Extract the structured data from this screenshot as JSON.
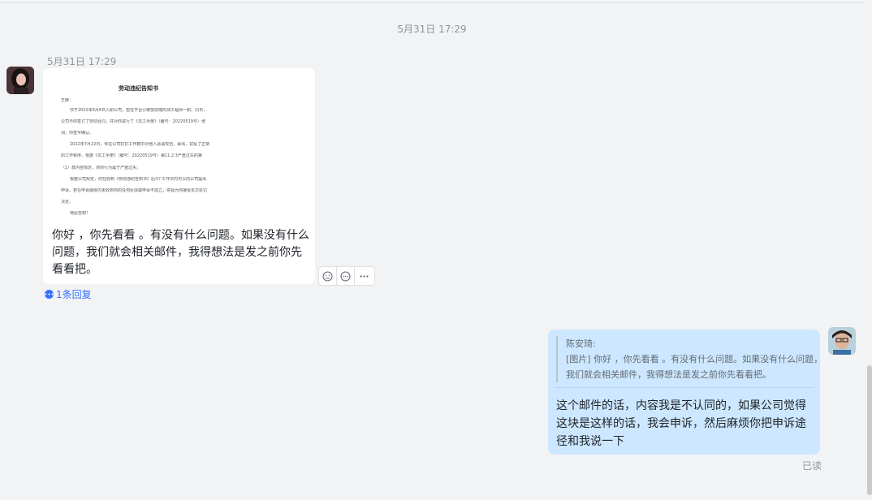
{
  "center_timestamp": "5月31日 17:29",
  "left_message": {
    "timestamp": "5月31日 17:29",
    "document": {
      "title": "劳动违纪告知书",
      "lines": [
        "王麻：",
        "你于2022年6月8日入职公司，担任平台引擎部前端的测工程师一职。同日，",
        "公司与你签订了劳动合同，并对你进行了《员工手册》（编号：20220519号）培",
        "训，你签字确认。",
        "2022年7月22日，你在公司钉钉工作群中对他人恶语攻击、辱骂，扰乱了正常",
        "的工作秩序。根据《员工手册》（编号：20220519号）第11.2.3严重过失的第",
        "（1）款内容规定，你的行为属于严重过失。",
        "根据公司规定，你在收到《劳动违纪告知书》后3个工作日内可以向公司提出",
        "申诉。若在申诉期限内未收到你的任何反馈或申诉不成立，将视为你接受本次处罚",
        "决定。",
        "特此告知！"
      ]
    },
    "text": " 你好 ，你先看看 。有没有什么问题。如果没有什么问题，我们就会相关邮件，我得想法是发之前你先看看把。",
    "reply_count_label": "1条回复"
  },
  "right_message": {
    "quote_author": "陈安琦:",
    "quote_text": "[图片] 你好 ，你先看看 。有没有什么问题。如果没有什么问题，我们就会相关邮件，我得想法是发之前你先看看把。",
    "text": "这个邮件的话，内容我是不认同的，如果公司觉得这块是这样的话，我会申诉，然后麻烦你把申诉途径和我说一下",
    "read_status": "已读"
  },
  "icons": {
    "emoji_reaction": "emoji-add-icon",
    "reply": "reply-icon",
    "more": "more-icon"
  },
  "colors": {
    "background": "#f2f3f5",
    "self_bubble": "#cce7ff",
    "link": "#3370ff"
  }
}
